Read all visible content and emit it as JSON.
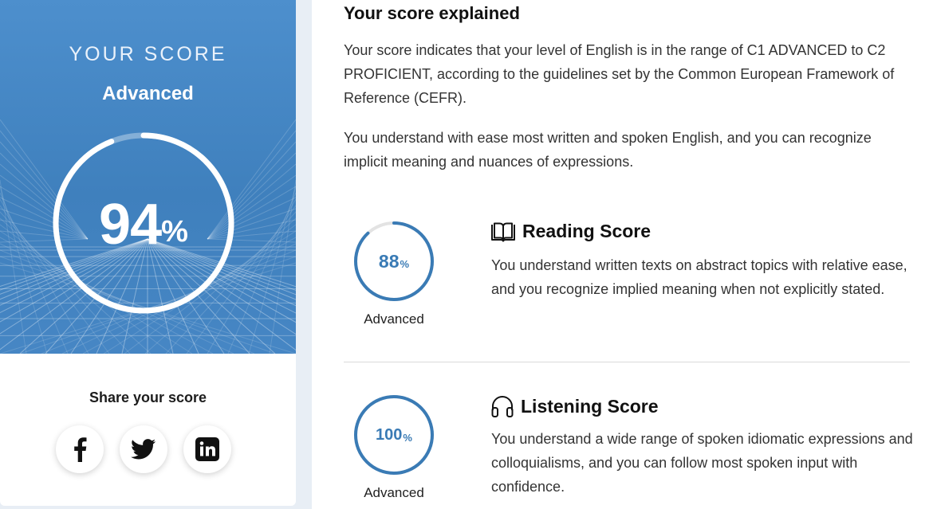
{
  "overall": {
    "label": "YOUR SCORE",
    "level": "Advanced",
    "score": "94",
    "percent_sign": "%",
    "progress": 0.94
  },
  "share": {
    "title": "Share your score",
    "buttons": [
      {
        "name": "facebook",
        "glyph": "f"
      },
      {
        "name": "twitter",
        "glyph": "twitter-bird"
      },
      {
        "name": "linkedin",
        "glyph": "in"
      }
    ]
  },
  "explanation": {
    "title": "Your score explained",
    "paragraph1": "Your score indicates that your level of English is in the range of C1 ADVANCED to C2 PROFICIENT, according to the guidelines set by the Common European Framework of Reference (CEFR).",
    "paragraph2": "You understand with ease most written and spoken English, and you can recognize implicit meaning and nuances of expressions."
  },
  "sections": [
    {
      "title": "Reading Score",
      "icon": "book-icon",
      "score": "88",
      "percent_sign": "%",
      "progress": 0.88,
      "level": "Advanced",
      "description": "You understand written texts on abstract topics with relative ease, and you recognize implied meaning when not explicitly stated."
    },
    {
      "title": "Listening Score",
      "icon": "headphones-icon",
      "score": "100",
      "percent_sign": "%",
      "progress": 1.0,
      "level": "Advanced",
      "description": "You understand a wide range of spoken idiomatic expressions and colloquialisms, and you can follow most spoken input with confidence."
    }
  ],
  "colors": {
    "accent": "#3a7bb5",
    "hero_top": "#4d8fcd",
    "hero_bottom": "#3f80bd",
    "track": "#e3e3e3"
  }
}
